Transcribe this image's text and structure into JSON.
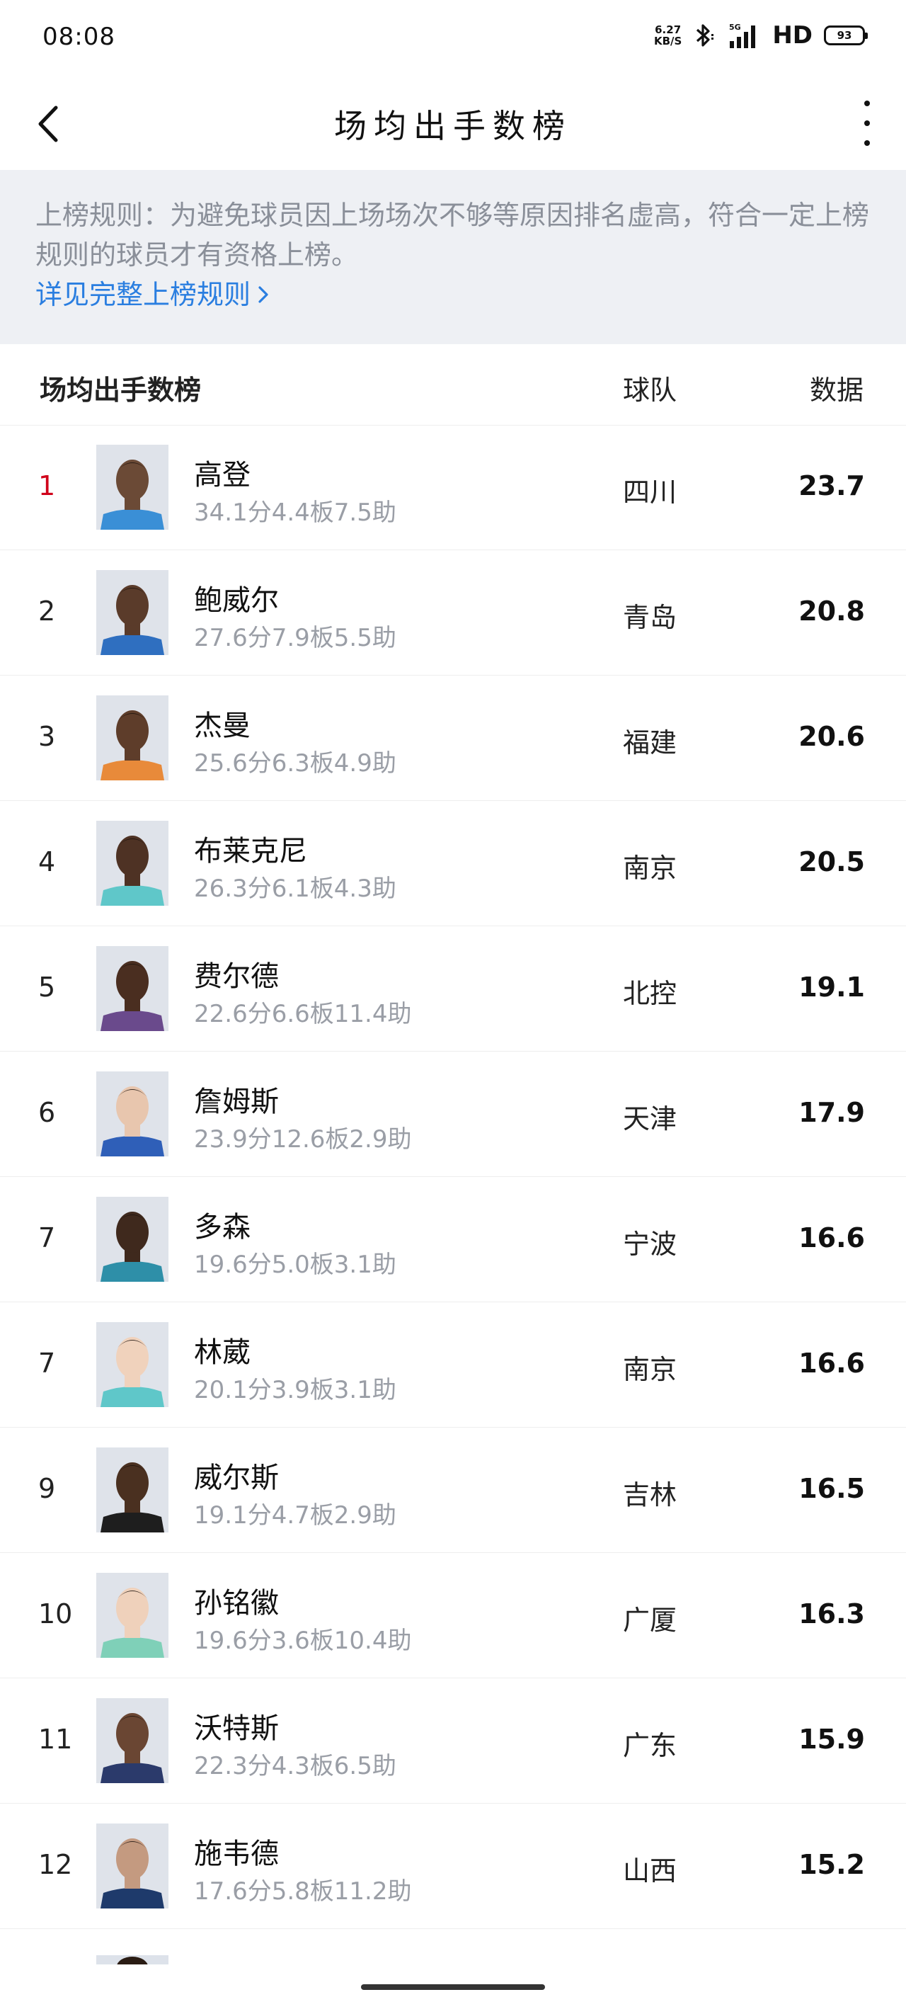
{
  "status": {
    "time": "08:08",
    "net_speed_value": "6.27",
    "net_speed_unit": "KB/S",
    "signal_label": "5G",
    "hd_label": "HD",
    "battery": "93"
  },
  "nav": {
    "title": "场均出手数榜"
  },
  "rules": {
    "text": "上榜规则：为避免球员因上场场次不够等原因排名虚高，符合一定上榜规则的球员才有资格上榜。",
    "link_label": "详见完整上榜规则"
  },
  "table": {
    "headers": {
      "name": "场均出手数榜",
      "team": "球队",
      "data": "数据"
    },
    "rows": [
      {
        "rank": "1",
        "name": "高登",
        "stats": "34.1分4.4板7.5助",
        "team": "四川",
        "value": "23.7",
        "skin": "#6b4a36",
        "jersey": "#3a8fd6"
      },
      {
        "rank": "2",
        "name": "鲍威尔",
        "stats": "27.6分7.9板5.5助",
        "team": "青岛",
        "value": "20.8",
        "skin": "#5a3b2a",
        "jersey": "#2f6fc0"
      },
      {
        "rank": "3",
        "name": "杰曼",
        "stats": "25.6分6.3板4.9助",
        "team": "福建",
        "value": "20.6",
        "skin": "#5e3d2a",
        "jersey": "#e88a3a"
      },
      {
        "rank": "4",
        "name": "布莱克尼",
        "stats": "26.3分6.1板4.3助",
        "team": "南京",
        "value": "20.5",
        "skin": "#4e3224",
        "jersey": "#5fc7c9"
      },
      {
        "rank": "5",
        "name": "费尔德",
        "stats": "22.6分6.6板11.4助",
        "team": "北控",
        "value": "19.1",
        "skin": "#4a2e20",
        "jersey": "#6a4a8c"
      },
      {
        "rank": "6",
        "name": "詹姆斯",
        "stats": "23.9分12.6板2.9助",
        "team": "天津",
        "value": "17.9",
        "skin": "#e8c6ae",
        "jersey": "#2f5fb8"
      },
      {
        "rank": "7",
        "name": "多森",
        "stats": "19.6分5.0板3.1助",
        "team": "宁波",
        "value": "16.6",
        "skin": "#3f291d",
        "jersey": "#2e8fa8"
      },
      {
        "rank": "7",
        "name": "林葳",
        "stats": "20.1分3.9板3.1助",
        "team": "南京",
        "value": "16.6",
        "skin": "#f0d2bc",
        "jersey": "#5fc7c9"
      },
      {
        "rank": "9",
        "name": "威尔斯",
        "stats": "19.1分4.7板2.9助",
        "team": "吉林",
        "value": "16.5",
        "skin": "#4a3020",
        "jersey": "#1e1e1e"
      },
      {
        "rank": "10",
        "name": "孙铭徽",
        "stats": "19.6分3.6板10.4助",
        "team": "广厦",
        "value": "16.3",
        "skin": "#efd1bb",
        "jersey": "#7fd0b8"
      },
      {
        "rank": "11",
        "name": "沃特斯",
        "stats": "22.3分4.3板6.5助",
        "team": "广东",
        "value": "15.9",
        "skin": "#6a4633",
        "jersey": "#2b3a6b"
      },
      {
        "rank": "12",
        "name": "施韦德",
        "stats": "17.6分5.8板11.2助",
        "team": "山西",
        "value": "15.2",
        "skin": "#c49a80",
        "jersey": "#1e3a6b"
      }
    ]
  }
}
